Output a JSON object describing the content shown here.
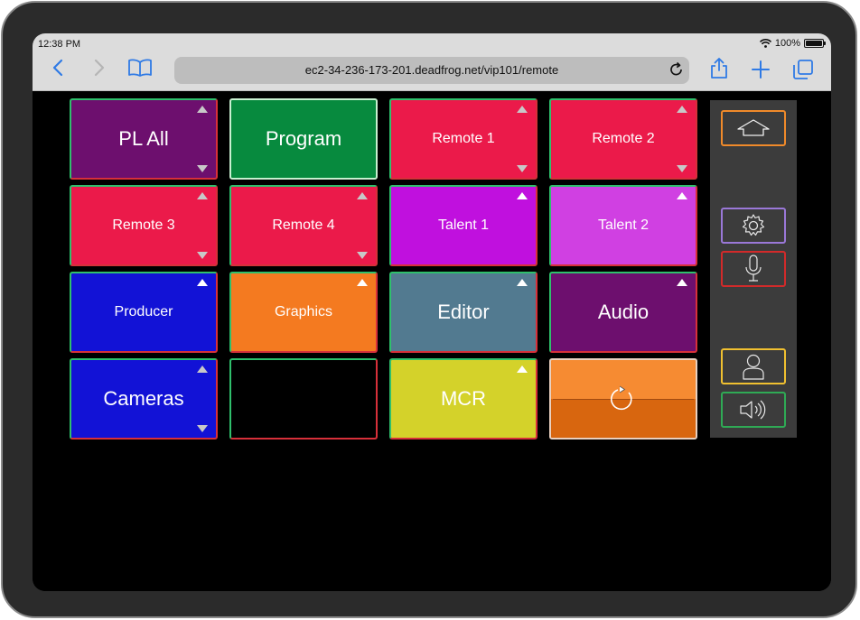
{
  "status": {
    "time": "12:38 PM",
    "battery": "100%",
    "battery_level": 1.0
  },
  "browser": {
    "url": "ec2-34-236-173-201.deadfrog.net/vip101/remote",
    "icons": [
      "back-icon",
      "forward-icon",
      "bookmarks-icon",
      "reload-icon",
      "share-icon",
      "new-tab-icon",
      "tabs-icon"
    ]
  },
  "tiles": [
    {
      "label": "PL All",
      "color": "#6d0f6e"
    },
    {
      "label": "Program",
      "color": "#078a3e"
    },
    {
      "label": "Remote 1",
      "color": "#eb1a4a"
    },
    {
      "label": "Remote 2",
      "color": "#eb1a4a"
    },
    {
      "label": "Remote 3",
      "color": "#eb1a4a"
    },
    {
      "label": "Remote 4",
      "color": "#eb1a4a"
    },
    {
      "label": "Talent 1",
      "color": "#c010de"
    },
    {
      "label": "Talent 2",
      "color": "#d040e2"
    },
    {
      "label": "Producer",
      "color": "#1212d6"
    },
    {
      "label": "Graphics",
      "color": "#f47a20"
    },
    {
      "label": "Editor",
      "color": "#527a90"
    },
    {
      "label": "Audio",
      "color": "#6d0f6e"
    },
    {
      "label": "Cameras",
      "color": "#1212d6"
    },
    {
      "label": "",
      "color": "#000000"
    },
    {
      "label": "MCR",
      "color": "#d4d22a"
    },
    {
      "label": "",
      "color": "#f68b32"
    }
  ],
  "side_panel": {
    "buttons": [
      {
        "name": "home-button",
        "icon": "home-icon",
        "border": "#f08a2a"
      },
      {
        "name": "settings-button",
        "icon": "gear-icon",
        "border": "#9a78d8"
      },
      {
        "name": "microphone-button",
        "icon": "microphone-icon",
        "border": "#d22a2a"
      },
      {
        "name": "user-button",
        "icon": "user-icon",
        "border": "#f0c030"
      },
      {
        "name": "speaker-button",
        "icon": "speaker-icon",
        "border": "#2faa55"
      }
    ]
  },
  "colors": {
    "accent": "#2f7ae5",
    "panel": "#3c3c3c",
    "talk_green": "#2fbf6c",
    "listen_red": "#d7303a"
  }
}
